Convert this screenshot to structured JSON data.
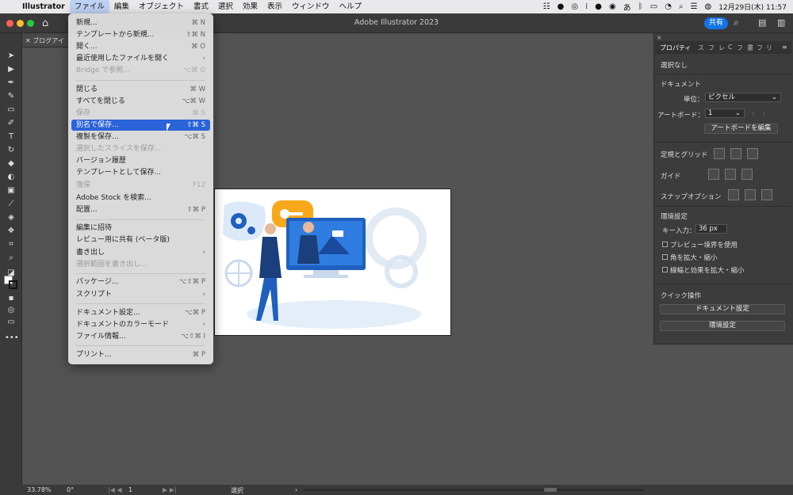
{
  "mac_menubar": {
    "app": "Illustrator",
    "items": [
      "ファイル",
      "編集",
      "オブジェクト",
      "書式",
      "選択",
      "効果",
      "表示",
      "ウィンドウ",
      "ヘルプ"
    ],
    "clock": "12月29日(木) 11:57"
  },
  "window": {
    "title": "Adobe Illustrator 2023",
    "share_label": "共有",
    "doc_tab": "ブログアイ"
  },
  "file_menu": [
    {
      "label": "新規...",
      "shortcut": "⌘ N",
      "enabled": true
    },
    {
      "label": "テンプレートから新規...",
      "shortcut": "⇧⌘ N",
      "enabled": true
    },
    {
      "label": "開く...",
      "shortcut": "⌘ O",
      "enabled": true
    },
    {
      "label": "最近使用したファイルを開く",
      "shortcut": "›",
      "enabled": true
    },
    {
      "label": "Bridge で参照...",
      "shortcut": "⌥⌘ O",
      "enabled": false
    },
    {
      "label": "閉じる",
      "shortcut": "⌘ W",
      "enabled": true
    },
    {
      "label": "すべてを閉じる",
      "shortcut": "⌥⌘ W",
      "enabled": true
    },
    {
      "label": "保存",
      "shortcut": "⌘ S",
      "enabled": false
    },
    {
      "label": "別名で保存...",
      "shortcut": "⇧⌘ S",
      "enabled": true,
      "highlighted": true
    },
    {
      "label": "複製を保存...",
      "shortcut": "⌥⌘ S",
      "enabled": true
    },
    {
      "label": "選択したスライスを保存...",
      "shortcut": "",
      "enabled": false
    },
    {
      "label": "バージョン履歴",
      "shortcut": "",
      "enabled": true
    },
    {
      "label": "テンプレートとして保存...",
      "shortcut": "",
      "enabled": true
    },
    {
      "label": "復帰",
      "shortcut": "F12",
      "enabled": false
    },
    {
      "label": "Adobe Stock を検索...",
      "shortcut": "",
      "enabled": true
    },
    {
      "label": "配置...",
      "shortcut": "⇧⌘ P",
      "enabled": true
    },
    {
      "label": "編集に招待",
      "shortcut": "",
      "enabled": true
    },
    {
      "label": "レビュー用に共有 (ベータ版)",
      "shortcut": "",
      "enabled": true
    },
    {
      "label": "書き出し",
      "shortcut": "›",
      "enabled": true
    },
    {
      "label": "選択範囲を書き出し...",
      "shortcut": "",
      "enabled": false
    },
    {
      "label": "パッケージ...",
      "shortcut": "⌥⇧⌘ P",
      "enabled": true
    },
    {
      "label": "スクリプト",
      "shortcut": "›",
      "enabled": true
    },
    {
      "label": "ドキュメント設定...",
      "shortcut": "⌥⌘ P",
      "enabled": true
    },
    {
      "label": "ドキュメントのカラーモード",
      "shortcut": "›",
      "enabled": true
    },
    {
      "label": "ファイル情報...",
      "shortcut": "⌥⇧⌘ I",
      "enabled": true
    },
    {
      "label": "プリント...",
      "shortcut": "⌘ P",
      "enabled": true
    }
  ],
  "properties_panel": {
    "tabs": [
      "プロパティ",
      "ス",
      "フ",
      "レ",
      "C",
      "フ",
      "書",
      "フ",
      "リ"
    ],
    "selection": "選択なし",
    "document_heading": "ドキュメント",
    "unit_label": "単位：",
    "unit_value": "ピクセル",
    "artboard_label": "アートボード：",
    "artboard_value": "1",
    "edit_artboard_button": "アートボードを編集",
    "rulers_grid_label": "定規とグリッド",
    "guides_label": "ガイド",
    "snap_label": "スナップオプション",
    "prefs_heading": "環境設定",
    "key_input_label": "キー入力：",
    "key_input_value": "36 px",
    "checkboxes": [
      "プレビュー境界を使用",
      "角を拡大・縮小",
      "線幅と効果を拡大・縮小"
    ],
    "quick_actions_heading": "クイック操作",
    "doc_setup_button": "ドキュメント設定",
    "prefs_button": "環境設定"
  },
  "status_bar": {
    "zoom": "33.78%",
    "rotation": "0°",
    "artboard_nav": "1",
    "tool": "選択"
  },
  "colors": {
    "accent": "#1473e6",
    "menu_highlight": "#2b63d8",
    "illustration_blue": "#1f5fbf",
    "key_bubble": "#f7a91b"
  }
}
